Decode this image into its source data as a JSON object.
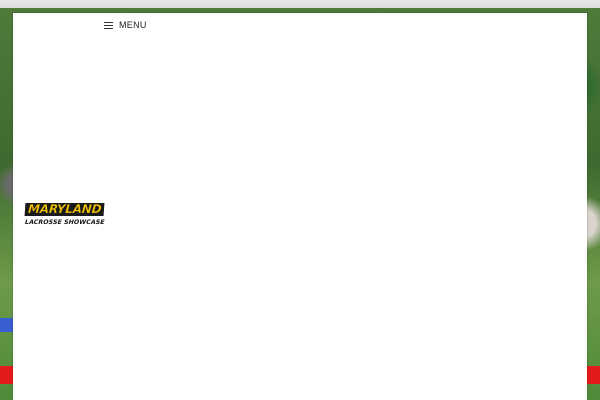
{
  "header": {
    "menu_label": "MENU"
  },
  "logo": {
    "line1": "MARYLAND",
    "line2": "LACROSSE SHOWCASE"
  }
}
